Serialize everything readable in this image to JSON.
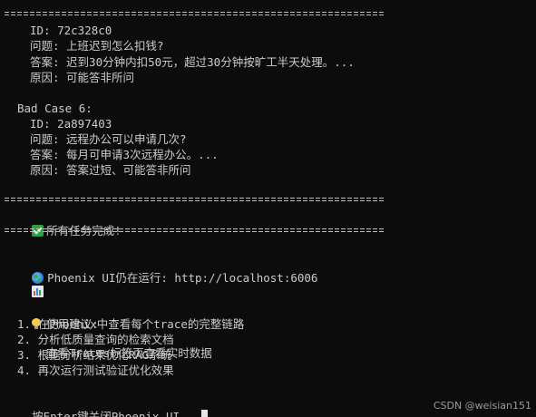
{
  "separator": "==========================================================",
  "case5": {
    "id": "ID: 72c328c0",
    "question": "问题: 上班迟到怎么扣钱?",
    "answer": "答案: 迟到30分钟内扣50元，超过30分钟按旷工半天处理。...",
    "reason": "原因: 可能答非所问"
  },
  "case6": {
    "heading": "Bad Case 6:",
    "id": "ID: 2a897403",
    "question": "问题: 远程办公可以申请几次?",
    "answer": "答案: 每月可申请3次远程办公。...",
    "reason": "原因: 答案过短、可能答非所问"
  },
  "status": {
    "done": "所有任务完成!",
    "icon": "check-icon",
    "color": "#2ea043"
  },
  "phoenix": {
    "running": "Phoenix UI仍在运行: http://localhost:6006",
    "running_icon": "globe-icon",
    "traces": "查看Traces标签页查看实时数据",
    "traces_icon": "chart-icon"
  },
  "tips": {
    "heading": "使用建议:",
    "icon": "bulb-icon",
    "items": [
      "1. 在Phoenix中查看每个trace的完整链路",
      "2. 分析低质量查询的检索文档",
      "3. 根据分析结果优化RAG系统",
      "4. 再次运行测试验证优化效果"
    ]
  },
  "prompt": "按Enter键关闭Phoenix UI...",
  "watermark": "CSDN @weisian151"
}
